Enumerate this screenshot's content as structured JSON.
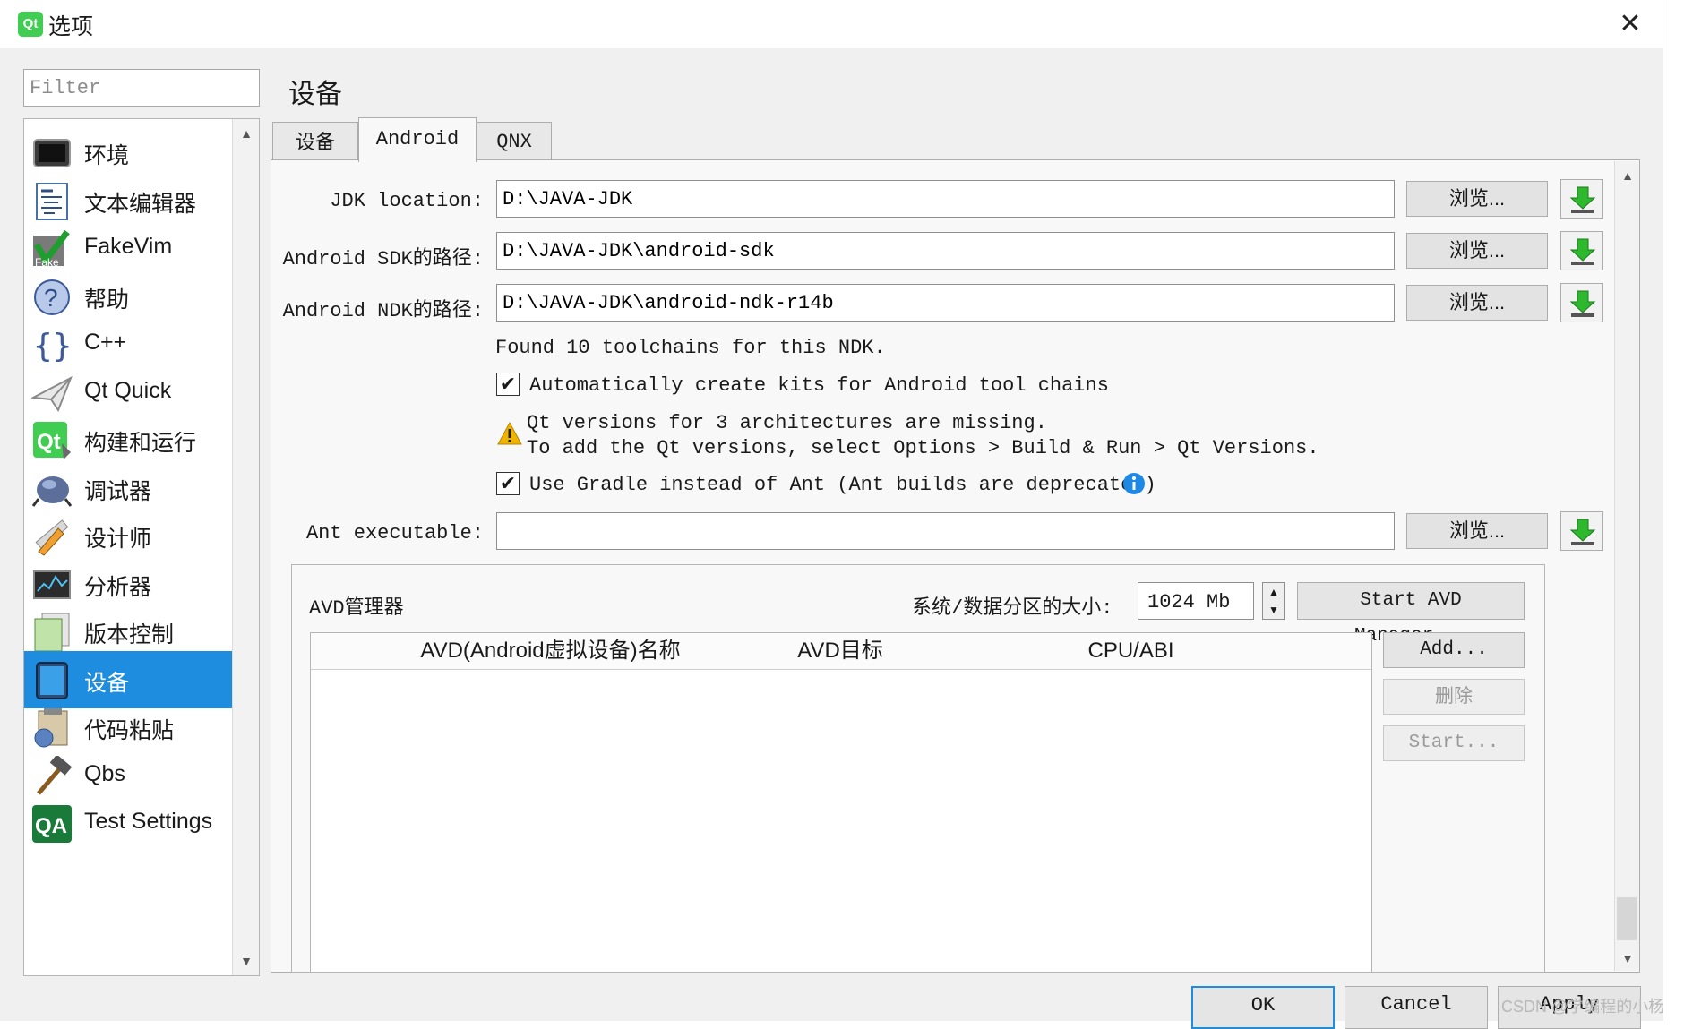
{
  "window": {
    "title": "选项",
    "app_icon_text": "Qt"
  },
  "filter": {
    "placeholder": "Filter"
  },
  "sidebar": {
    "items": [
      {
        "label": "环境",
        "icon": "monitor-icon"
      },
      {
        "label": "文本编辑器",
        "icon": "text-editor-icon"
      },
      {
        "label": "FakeVim",
        "icon": "fakevim-icon"
      },
      {
        "label": "帮助",
        "icon": "help-icon"
      },
      {
        "label": "C++",
        "icon": "braces-icon"
      },
      {
        "label": "Qt Quick",
        "icon": "paper-plane-icon"
      },
      {
        "label": "构建和运行",
        "icon": "qt-build-icon"
      },
      {
        "label": "调试器",
        "icon": "bug-icon"
      },
      {
        "label": "设计师",
        "icon": "designer-icon"
      },
      {
        "label": "分析器",
        "icon": "analyzer-icon"
      },
      {
        "label": "版本控制",
        "icon": "version-control-icon"
      },
      {
        "label": "设备",
        "icon": "device-icon",
        "selected": true
      },
      {
        "label": "代码粘贴",
        "icon": "code-paste-icon"
      },
      {
        "label": "Qbs",
        "icon": "hammer-icon"
      },
      {
        "label": "Test Settings",
        "icon": "qa-icon"
      }
    ]
  },
  "page": {
    "title": "设备"
  },
  "tabs": [
    {
      "label": "设备",
      "active": false
    },
    {
      "label": "Android",
      "active": true
    },
    {
      "label": "QNX",
      "active": false
    }
  ],
  "android": {
    "jdk_label": "JDK location:",
    "jdk_value": "D:\\JAVA-JDK",
    "sdk_label": "Android SDK的路径:",
    "sdk_value": "D:\\JAVA-JDK\\android-sdk",
    "ndk_label": "Android NDK的路径:",
    "ndk_value": "D:\\JAVA-JDK\\android-ndk-r14b",
    "browse_label": "浏览...",
    "toolchains_info": "Found 10 toolchains for this NDK.",
    "auto_kits_label": "Automatically create kits for Android tool chains",
    "auto_kits_checked": true,
    "warning_line1": "Qt versions for 3 architectures are missing.",
    "warning_line2": "To add the Qt versions, select Options > Build & Run > Qt Versions.",
    "gradle_label": "Use Gradle instead of Ant (Ant builds are deprecated)",
    "gradle_checked": true,
    "ant_label": "Ant executable:",
    "ant_value": ""
  },
  "avd": {
    "group_label": "AVD管理器",
    "partition_label": "系统/数据分区的大小:",
    "partition_value": "1024 Mb",
    "start_manager_label": "Start AVD Manager...",
    "columns": [
      "AVD(Android虚拟设备)名称",
      "AVD目标",
      "CPU/ABI"
    ],
    "rows": [],
    "add_label": "Add...",
    "delete_label": "删除",
    "start_label": "Start..."
  },
  "footer": {
    "ok_label": "OK",
    "cancel_label": "Cancel",
    "apply_label": "Apply"
  },
  "watermark": "CSDN @学编程的小杨",
  "colors": {
    "selection": "#1e8de0",
    "download_green": "#2eb82e",
    "warning": "#f0b400",
    "info": "#1e88e5"
  }
}
